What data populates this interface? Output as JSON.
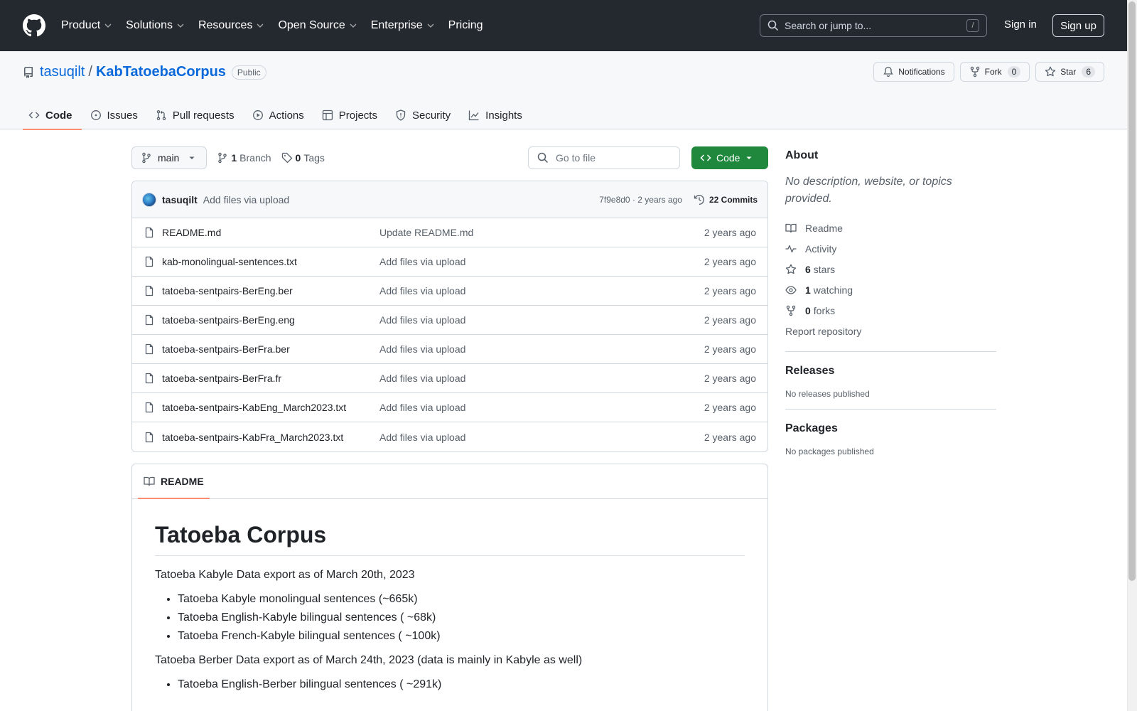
{
  "header": {
    "nav": [
      "Product",
      "Solutions",
      "Resources",
      "Open Source",
      "Enterprise",
      "Pricing"
    ],
    "search_placeholder": "Search or jump to...",
    "search_shortcut": "/",
    "signin": "Sign in",
    "signup": "Sign up"
  },
  "repo": {
    "owner": "tasuqilt",
    "separator": "/",
    "name": "KabTatoebaCorpus",
    "visibility": "Public",
    "actions": {
      "notifications": "Notifications",
      "fork": "Fork",
      "fork_count": "0",
      "star": "Star",
      "star_count": "6"
    },
    "tabs": [
      "Code",
      "Issues",
      "Pull requests",
      "Actions",
      "Projects",
      "Security",
      "Insights"
    ]
  },
  "toolbar": {
    "branch": "main",
    "branch_count": "1",
    "branch_label": "Branch",
    "tag_count": "0",
    "tag_label": "Tags",
    "goto_placeholder": "Go to file",
    "code_button": "Code"
  },
  "commit": {
    "user": "tasuqilt",
    "message": "Add files via upload",
    "hash_age": "7f9e8d0 · 2 years ago",
    "commits_label": "22 Commits"
  },
  "files": [
    {
      "name": "README.md",
      "message": "Update README.md",
      "age": "2 years ago"
    },
    {
      "name": "kab-monolingual-sentences.txt",
      "message": "Add files via upload",
      "age": "2 years ago"
    },
    {
      "name": "tatoeba-sentpairs-BerEng.ber",
      "message": "Add files via upload",
      "age": "2 years ago"
    },
    {
      "name": "tatoeba-sentpairs-BerEng.eng",
      "message": "Add files via upload",
      "age": "2 years ago"
    },
    {
      "name": "tatoeba-sentpairs-BerFra.ber",
      "message": "Add files via upload",
      "age": "2 years ago"
    },
    {
      "name": "tatoeba-sentpairs-BerFra.fr",
      "message": "Add files via upload",
      "age": "2 years ago"
    },
    {
      "name": "tatoeba-sentpairs-KabEng_March2023.txt",
      "message": "Add files via upload",
      "age": "2 years ago"
    },
    {
      "name": "tatoeba-sentpairs-KabFra_March2023.txt",
      "message": "Add files via upload",
      "age": "2 years ago"
    }
  ],
  "readme": {
    "tab": "README",
    "title": "Tatoeba Corpus",
    "p1": "Tatoeba Kabyle Data export as of March 20th, 2023",
    "list1": [
      "Tatoeba Kabyle monolingual sentences (~665k)",
      "Tatoeba English-Kabyle bilingual sentences ( ~68k)",
      "Tatoeba French-Kabyle bilingual sentences ( ~100k)"
    ],
    "p2": "Tatoeba Berber Data export as of March 24th, 2023 (data is mainly in Kabyle as well)",
    "list2": [
      "Tatoeba English-Berber bilingual sentences ( ~291k)"
    ]
  },
  "sidebar": {
    "about_title": "About",
    "description": "No description, website, or topics provided.",
    "readme": "Readme",
    "activity": "Activity",
    "stars_count": "6",
    "stars_label": "stars",
    "watching_count": "1",
    "watching_label": "watching",
    "forks_count": "0",
    "forks_label": "forks",
    "report": "Report repository",
    "releases_title": "Releases",
    "releases_sub": "No releases published",
    "packages_title": "Packages",
    "packages_sub": "No packages published"
  }
}
